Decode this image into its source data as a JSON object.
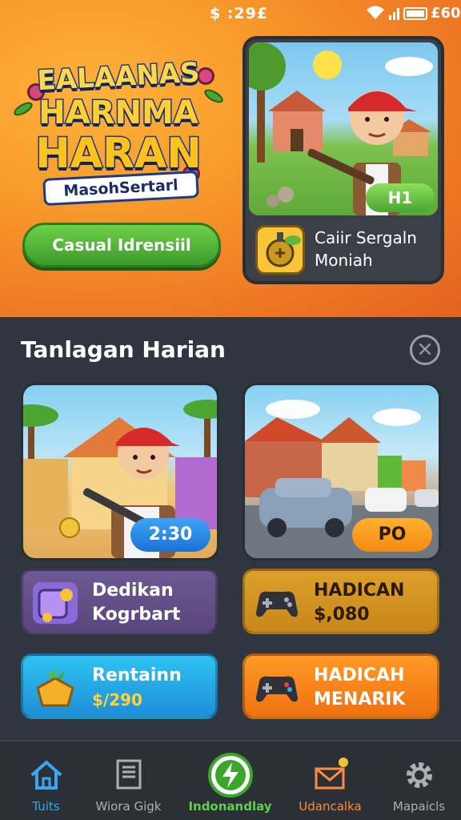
{
  "status_bar": {
    "time": "$ :29£",
    "battery_text": "£60"
  },
  "hero": {
    "logo_line1": "EALAANAS",
    "logo_line2": "HARNMA",
    "logo_line3": "HARAN",
    "logo_sub": "MasohSertarl",
    "play_button": "Casual Idrensiil",
    "feature_badge": "H1",
    "feature_title_1": "Caiir Sergaln",
    "feature_title_2": "Moniah"
  },
  "section": {
    "title": "Tanlagan Harian",
    "close_symbol": "×"
  },
  "cards": [
    {
      "badge": "2:30"
    },
    {
      "badge": "PO"
    }
  ],
  "tiles": [
    {
      "line1": "Dedikan",
      "line2": "Kogrbart"
    },
    {
      "line1": "HADICAN",
      "line2": "$,080"
    },
    {
      "line1": "Rentainn",
      "line2": "$/290"
    },
    {
      "line1": "HADICAH",
      "line2": "MENARIK"
    }
  ],
  "nav": [
    {
      "label": "Tuits",
      "icon": "home-icon"
    },
    {
      "label": "Wiora Gigk",
      "icon": "list-icon"
    },
    {
      "label": "Indonandlay",
      "icon": "bolt-icon"
    },
    {
      "label": "Udancalka",
      "icon": "mail-icon"
    },
    {
      "label": "Mapaicls",
      "icon": "gear-icon"
    }
  ],
  "colors": {
    "accent_blue": "#3aa6f2",
    "accent_green": "#5fd14a",
    "accent_orange": "#ff8a3a"
  }
}
